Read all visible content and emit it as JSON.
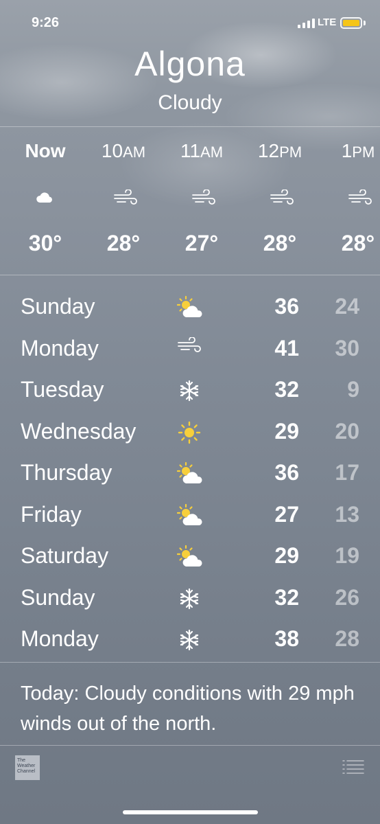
{
  "status_bar": {
    "time": "9:26",
    "network": "LTE",
    "battery_color": "#f5c518"
  },
  "header": {
    "city": "Algona",
    "condition": "Cloudy"
  },
  "hourly": [
    {
      "label": "Now",
      "suffix": "",
      "icon": "cloud-icon",
      "temp": "30°"
    },
    {
      "label": "10",
      "suffix": "AM",
      "icon": "wind-icon",
      "temp": "28°"
    },
    {
      "label": "11",
      "suffix": "AM",
      "icon": "wind-icon",
      "temp": "27°"
    },
    {
      "label": "12",
      "suffix": "PM",
      "icon": "wind-icon",
      "temp": "28°"
    },
    {
      "label": "1",
      "suffix": "PM",
      "icon": "wind-icon",
      "temp": "28°"
    }
  ],
  "daily": [
    {
      "day": "Sunday",
      "icon": "partly-sunny-icon",
      "high": "36",
      "low": "24"
    },
    {
      "day": "Monday",
      "icon": "wind-icon",
      "high": "41",
      "low": "30"
    },
    {
      "day": "Tuesday",
      "icon": "snowflake-icon",
      "high": "32",
      "low": "9"
    },
    {
      "day": "Wednesday",
      "icon": "sun-icon",
      "high": "29",
      "low": "20"
    },
    {
      "day": "Thursday",
      "icon": "partly-sunny-icon",
      "high": "36",
      "low": "17"
    },
    {
      "day": "Friday",
      "icon": "partly-sunny-icon",
      "high": "27",
      "low": "13"
    },
    {
      "day": "Saturday",
      "icon": "partly-sunny-icon",
      "high": "29",
      "low": "19"
    },
    {
      "day": "Sunday",
      "icon": "snowflake-icon",
      "high": "32",
      "low": "26"
    },
    {
      "day": "Monday",
      "icon": "snowflake-icon",
      "high": "38",
      "low": "28"
    }
  ],
  "summary": "Today: Cloudy conditions with 29 mph winds out of the north.",
  "footer": {
    "logo_text": "The Weather Channel",
    "list_icon": "list-icon"
  },
  "colors": {
    "sun": "#f7cf3b",
    "cloud": "#ffffff"
  }
}
